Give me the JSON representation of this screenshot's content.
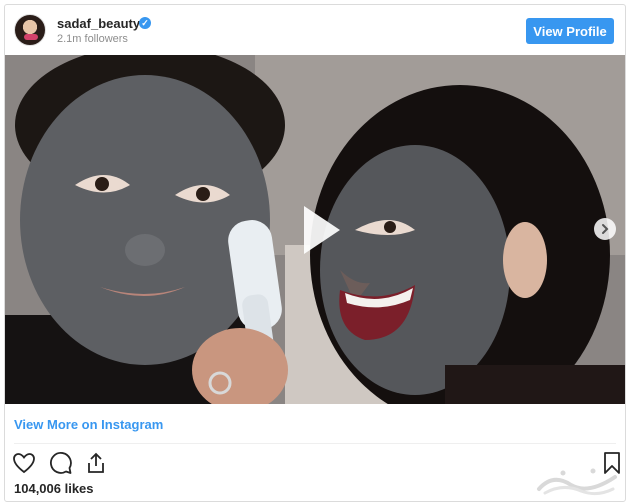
{
  "header": {
    "username": "sadaf_beauty",
    "followers": "2.1m followers",
    "view_profile_label": "View Profile"
  },
  "media": {
    "type": "video",
    "play_icon": "play-icon",
    "next_icon": "chevron-right-icon"
  },
  "footer": {
    "view_more_label": "View More on Instagram",
    "likes": "104,006 likes",
    "icons": [
      "heart-icon",
      "comment-icon",
      "share-icon",
      "bookmark-icon"
    ]
  },
  "colors": {
    "accent": "#3897f0",
    "text": "#262626",
    "muted": "#8e8e8e"
  }
}
